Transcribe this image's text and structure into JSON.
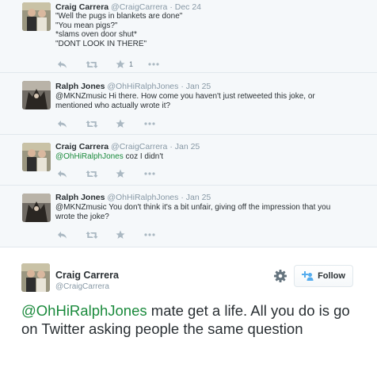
{
  "conversation": [
    {
      "name": "Craig Carrera",
      "handle": "@CraigCarrera",
      "time": "Dec 24",
      "lines": [
        "\"Well the pugs in blankets are done\"",
        "\"You mean pigs?\"",
        "*slams oven door shut*",
        "\"DONT LOOK IN THERE\""
      ],
      "favorite_count": "1",
      "avatar": "craig-photo"
    },
    {
      "name": "Ralph Jones",
      "handle": "@OhHiRalphJones",
      "time": "Jan 25",
      "lines": [
        "@MKNZmusic Hi there. How come you haven't just retweeted this joke, or",
        "mentioned who actually wrote it?"
      ],
      "avatar": "ralph-photo"
    },
    {
      "name": "Craig Carrera",
      "handle": "@CraigCarrera",
      "time": "Jan 25",
      "mention": "@OhHiRalphJones",
      "rest": " coz I didn't",
      "avatar": "craig-photo"
    },
    {
      "name": "Ralph Jones",
      "handle": "@OhHiRalphJones",
      "time": "Jan 25",
      "lines": [
        "@MKNZmusic You don't think it's a bit unfair, giving off the impression that you",
        "wrote the joke?"
      ],
      "avatar": "ralph-photo"
    }
  ],
  "separator": "·",
  "more_label": "•••",
  "main_tweet": {
    "name": "Craig Carrera",
    "handle": "@CraigCarrera",
    "follow_label": "Follow",
    "mention": "@OhHiRalphJones",
    "text": " mate get a life. All you do is go on Twitter asking people the same question"
  },
  "colors": {
    "mention": "#1a8a3c",
    "follow_icon": "#55acee",
    "action_icon": "#aab8c2"
  },
  "icons": [
    "reply-icon",
    "retweet-icon",
    "favorite-icon",
    "more-icon",
    "gear-icon",
    "follow-person-icon"
  ]
}
